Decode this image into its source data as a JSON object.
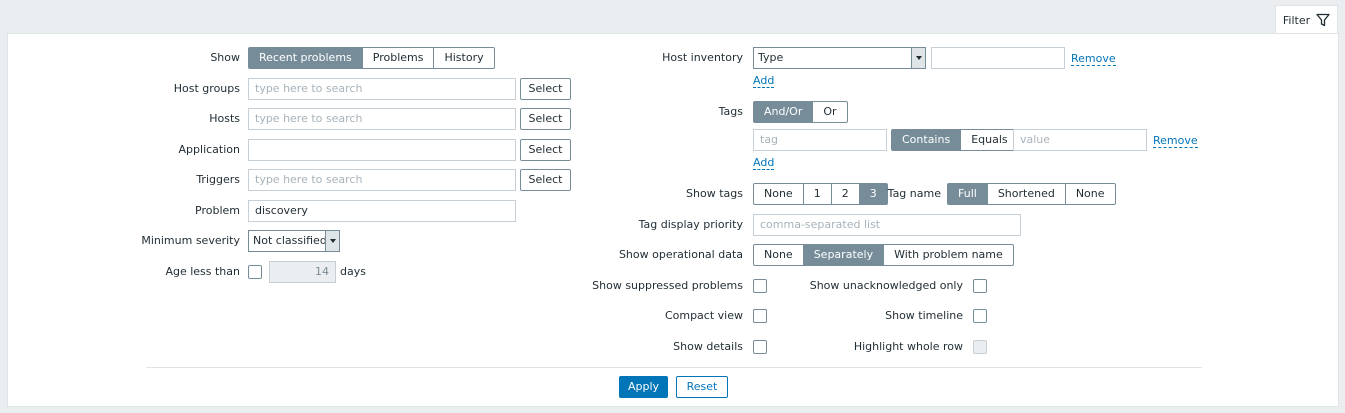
{
  "filter_tab": {
    "label": "Filter",
    "icon": "funnel-icon"
  },
  "left": {
    "show": {
      "label": "Show",
      "options": [
        "Recent problems",
        "Problems",
        "History"
      ],
      "active": "Recent problems"
    },
    "host_groups": {
      "label": "Host groups",
      "placeholder": "type here to search",
      "button": "Select"
    },
    "hosts": {
      "label": "Hosts",
      "placeholder": "type here to search",
      "button": "Select"
    },
    "application": {
      "label": "Application",
      "value": "",
      "button": "Select"
    },
    "triggers": {
      "label": "Triggers",
      "placeholder": "type here to search",
      "button": "Select"
    },
    "problem": {
      "label": "Problem",
      "value": "discovery"
    },
    "min_severity": {
      "label": "Minimum severity",
      "value": "Not classified"
    },
    "age": {
      "label": "Age less than",
      "checked": false,
      "value": "14",
      "unit": "days"
    }
  },
  "right": {
    "host_inventory": {
      "label": "Host inventory",
      "field": "Type",
      "value": "",
      "remove": "Remove",
      "add": "Add"
    },
    "tags": {
      "label": "Tags",
      "operator": {
        "options": [
          "And/Or",
          "Or"
        ],
        "active": "And/Or"
      },
      "tag_placeholder": "tag",
      "match": {
        "options": [
          "Contains",
          "Equals"
        ],
        "active": "Contains"
      },
      "value_placeholder": "value",
      "remove": "Remove",
      "add": "Add"
    },
    "show_tags": {
      "label": "Show tags",
      "options": [
        "None",
        "1",
        "2",
        "3"
      ],
      "active": "3"
    },
    "tag_name": {
      "label": "Tag name",
      "options": [
        "Full",
        "Shortened",
        "None"
      ],
      "active": "Full"
    },
    "tag_priority": {
      "label": "Tag display priority",
      "placeholder": "comma-separated list"
    },
    "operational_data": {
      "label": "Show operational data",
      "options": [
        "None",
        "Separately",
        "With problem name"
      ],
      "active": "Separately"
    },
    "show_suppressed": {
      "label": "Show suppressed problems",
      "checked": false
    },
    "show_unack": {
      "label": "Show unacknowledged only",
      "checked": false
    },
    "compact_view": {
      "label": "Compact view",
      "checked": false
    },
    "show_timeline": {
      "label": "Show timeline",
      "checked": false
    },
    "show_details": {
      "label": "Show details",
      "checked": false
    },
    "highlight_row": {
      "label": "Highlight whole row",
      "checked": false,
      "disabled": true
    }
  },
  "actions": {
    "apply": "Apply",
    "reset": "Reset"
  },
  "colors": {
    "accent": "#0275b8",
    "segment_active": "#768d99",
    "background": "#ebeef0"
  }
}
